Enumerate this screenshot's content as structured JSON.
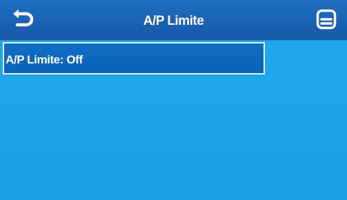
{
  "header": {
    "title": "A/P Limite",
    "back_icon": "back-arrow-icon",
    "save_icon": "save-icon"
  },
  "setting": {
    "label": "A/P Limite: Off"
  },
  "colors": {
    "header": "#1a62b3",
    "background": "#1ea6ea",
    "selected_row": "#0b63b8",
    "text": "#ffffff"
  }
}
